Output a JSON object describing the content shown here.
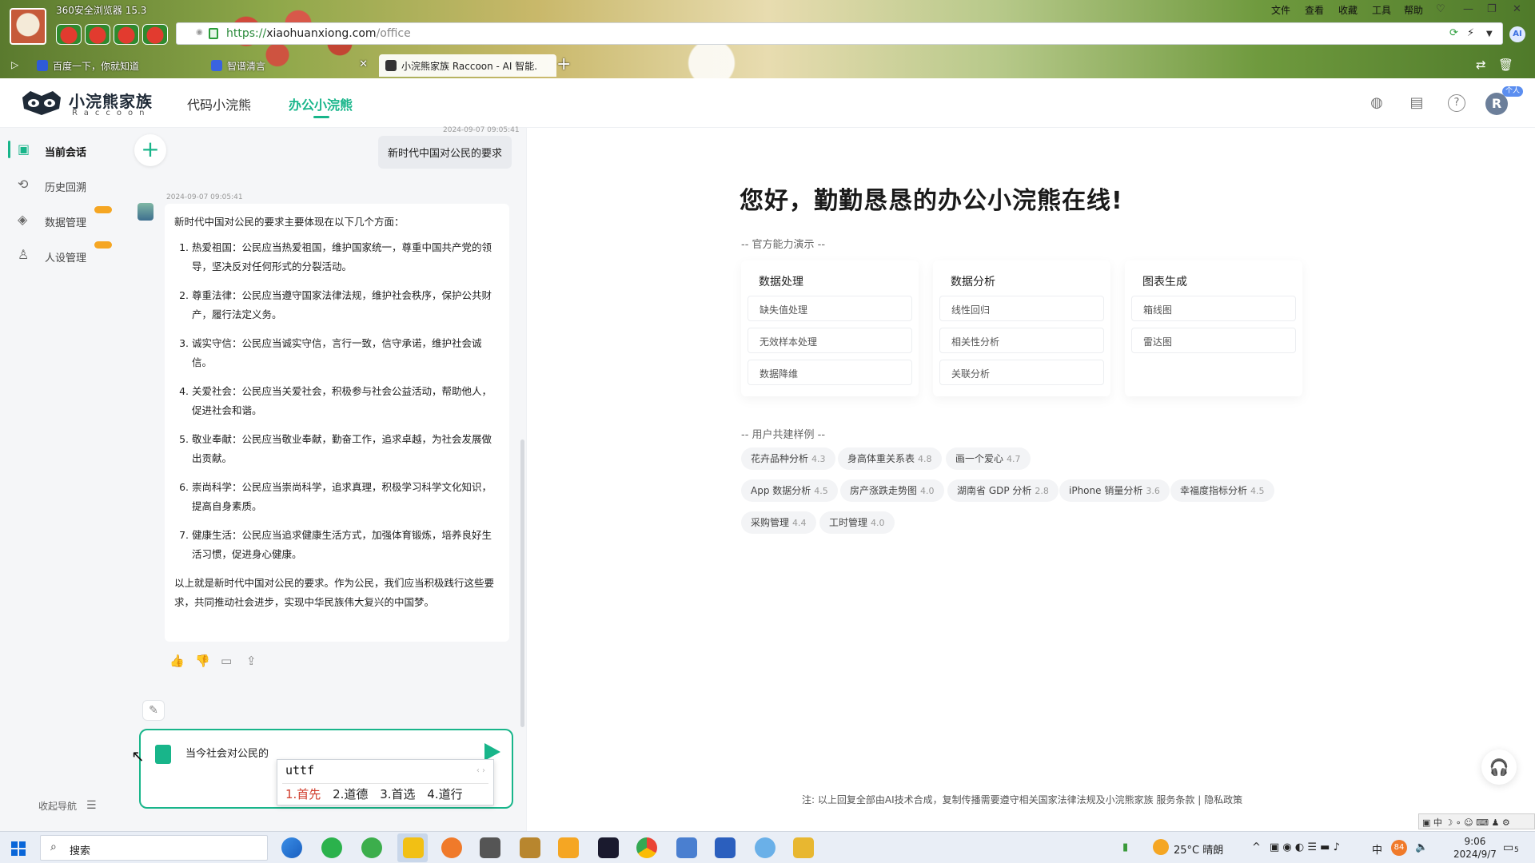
{
  "browser": {
    "name": "360安全浏览器 15.3",
    "menu": [
      "文件",
      "查看",
      "收藏",
      "工具",
      "帮助"
    ],
    "url_scheme": "https://",
    "url_host": "xiaohuanxiong.com",
    "url_path": "/office",
    "tabs": [
      {
        "label": "百度一下，你就知道"
      },
      {
        "label": "智谱清言"
      },
      {
        "label": "小浣熊家族 Raccoon - AI 智能..."
      }
    ],
    "ai_label": "AI"
  },
  "header": {
    "brand": "小浣熊家族",
    "brand_sub": "Raccoon",
    "nav": [
      {
        "label": "代码小浣熊"
      },
      {
        "label": "办公小浣熊"
      }
    ],
    "user_initial": "R",
    "user_badge": "个人"
  },
  "sidebar": {
    "items": [
      {
        "label": "当前会话",
        "icon": "chat-icon"
      },
      {
        "label": "历史回溯",
        "icon": "history-icon"
      },
      {
        "label": "数据管理",
        "icon": "layers-icon"
      },
      {
        "label": "人设管理",
        "icon": "person-icon"
      }
    ],
    "collapse_label": "收起导航"
  },
  "chat": {
    "user_timestamp": "2024-09-07 09:05:41",
    "user_message": "新时代中国对公民的要求",
    "bot_timestamp": "2024-09-07 09:05:41",
    "bot_intro": "新时代中国对公民的要求主要体现在以下几个方面：",
    "bot_points": [
      "热爱祖国：公民应当热爱祖国，维护国家统一，尊重中国共产党的领导，坚决反对任何形式的分裂活动。",
      "尊重法律：公民应当遵守国家法律法规，维护社会秩序，保护公共财产，履行法定义务。",
      "诚实守信：公民应当诚实守信，言行一致，信守承诺，维护社会诚信。",
      "关爱社会：公民应当关爱社会，积极参与社会公益活动，帮助他人，促进社会和谐。",
      "敬业奉献：公民应当敬业奉献，勤奋工作，追求卓越，为社会发展做出贡献。",
      "崇尚科学：公民应当崇尚科学，追求真理，积极学习科学文化知识，提高自身素质。",
      "健康生活：公民应当追求健康生活方式，加强体育锻炼，培养良好生活习惯，促进身心健康。"
    ],
    "bot_outro": "以上就是新时代中国对公民的要求。作为公民，我们应当积极践行这些要求，共同推动社会进步，实现中华民族伟大复兴的中国梦。",
    "input_value": "当今社会对公民的"
  },
  "ime": {
    "composition": "uttf",
    "candidates": [
      "1.首先",
      "2.道德",
      "3.首选",
      "4.道行"
    ]
  },
  "main": {
    "greeting": "您好，勤勤恳恳的办公小浣熊在线!",
    "official_label": "-- 官方能力演示 --",
    "capabilities": [
      {
        "title": "数据处理",
        "items": [
          "缺失值处理",
          "无效样本处理",
          "数据降维"
        ]
      },
      {
        "title": "数据分析",
        "items": [
          "线性回归",
          "相关性分析",
          "关联分析"
        ]
      },
      {
        "title": "图表生成",
        "items": [
          "箱线图",
          "雷达图"
        ]
      }
    ],
    "user_label": "-- 用户共建样例 --",
    "examples": [
      {
        "name": "花卉品种分析",
        "score": "4.3"
      },
      {
        "name": "身高体重关系表",
        "score": "4.8"
      },
      {
        "name": "画一个爱心",
        "score": "4.7"
      },
      {
        "name": "App 数据分析",
        "score": "4.5"
      },
      {
        "name": "房产涨跌走势图",
        "score": "4.0"
      },
      {
        "name": "湖南省 GDP 分析",
        "score": "2.8"
      },
      {
        "name": "iPhone 销量分析",
        "score": "3.6"
      },
      {
        "name": "幸福度指标分析",
        "score": "4.5"
      },
      {
        "name": "采购管理",
        "score": "4.4"
      },
      {
        "name": "工时管理",
        "score": "4.0"
      }
    ],
    "footer_note": "注: 以上回复全部由AI技术合成，复制传播需要遵守相关国家法律法规及小浣熊家族 服务条款 | 隐私政策"
  },
  "taskbar": {
    "search_label": "搜索",
    "weather": "25°C 晴朗",
    "ime_indicator": "中",
    "time": "9:06",
    "date": "2024/9/7",
    "notify_count": "5",
    "badge_number": "84"
  },
  "colors": {
    "accent": "#18b58a",
    "taskbar": "#e9eef6"
  }
}
